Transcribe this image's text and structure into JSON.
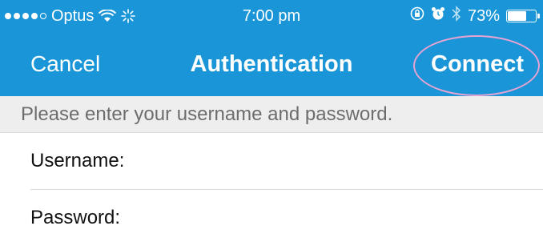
{
  "status_bar": {
    "carrier": "Optus",
    "time": "7:00 pm",
    "battery": "73%",
    "battery_level": 0.73,
    "icons": [
      "signal-dots",
      "wifi-icon",
      "activity-spinner-icon",
      "orientation-lock-icon",
      "alarm-icon",
      "bluetooth-icon",
      "battery-icon"
    ]
  },
  "nav": {
    "cancel_label": "Cancel",
    "title": "Authentication",
    "connect_label": "Connect"
  },
  "instruction": "Please enter your username and password.",
  "form": {
    "username_label": "Username:",
    "username_value": "",
    "password_label": "Password:",
    "password_value": ""
  },
  "colors": {
    "header_blue": "#1a96d8",
    "instruction_bg": "#eeeeee",
    "highlight_oval": "#e7a3d2"
  }
}
